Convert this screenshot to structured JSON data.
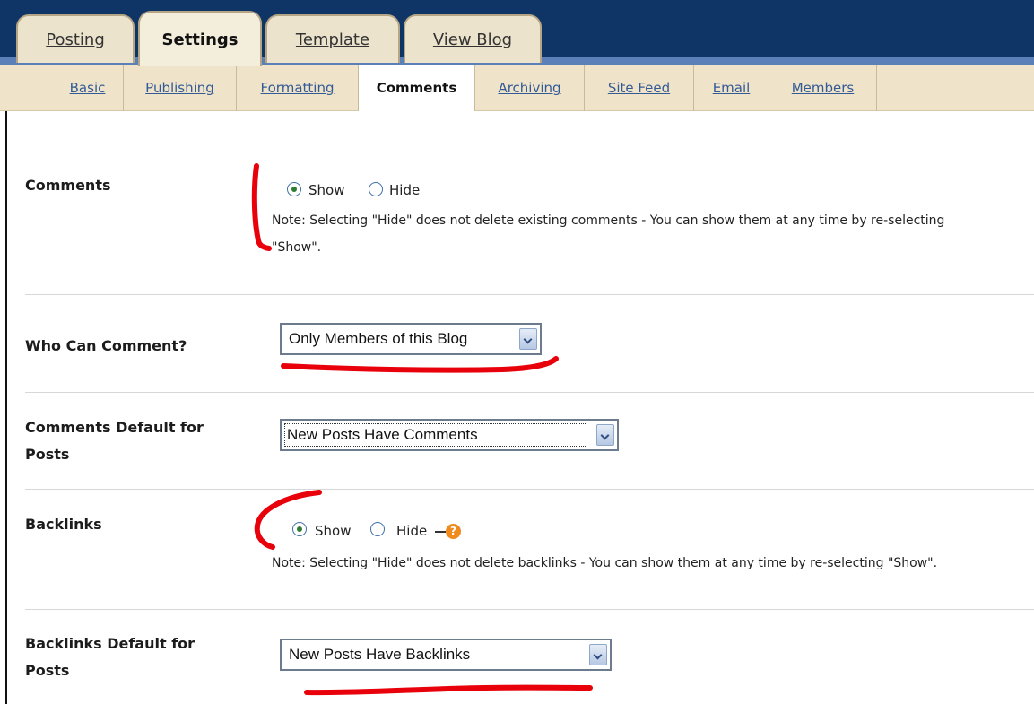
{
  "main_tabs": [
    {
      "label": "Posting"
    },
    {
      "label": "Settings"
    },
    {
      "label": "Template"
    },
    {
      "label": "View Blog"
    }
  ],
  "sub_tabs": [
    {
      "label": "Basic"
    },
    {
      "label": "Publishing"
    },
    {
      "label": "Formatting"
    },
    {
      "label": "Comments"
    },
    {
      "label": "Archiving"
    },
    {
      "label": "Site Feed"
    },
    {
      "label": "Email"
    },
    {
      "label": "Members"
    }
  ],
  "settings": {
    "comments": {
      "label": "Comments",
      "option_show": "Show",
      "option_hide": "Hide",
      "selected": "Show",
      "note_line1": "Note: Selecting \"Hide\" does not delete existing comments - You can show them at any time by re-selecting",
      "note_line2": "\"Show\"."
    },
    "who_can_comment": {
      "label": "Who Can Comment?",
      "value": "Only Members of this Blog"
    },
    "comments_default": {
      "label_line1": "Comments Default for",
      "label_line2": "Posts",
      "value": "New Posts Have Comments"
    },
    "backlinks": {
      "label": "Backlinks",
      "option_show": "Show",
      "option_hide": "Hide",
      "selected": "Show",
      "help_icon": "?",
      "note": "Note: Selecting \"Hide\" does not delete backlinks - You can show them at any time by re-selecting \"Show\"."
    },
    "backlinks_default": {
      "label_line1": "Backlinks Default for",
      "label_line2": "Posts",
      "value": "New Posts Have Backlinks"
    }
  },
  "colors": {
    "top_bar": "#0f3466",
    "tab_bg": "#ece3cd",
    "sub_bar": "#efe3c9",
    "link": "#335b96",
    "annotation": "#e8000a",
    "help_icon": "#f08a1c"
  }
}
